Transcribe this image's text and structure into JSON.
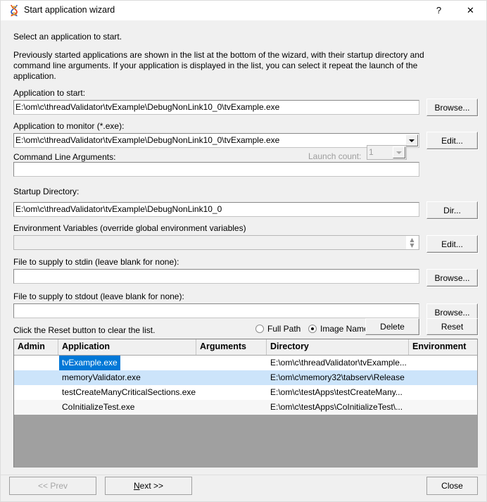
{
  "window": {
    "title": "Start application wizard",
    "icon": "dna-helix-icon",
    "help_label": "?",
    "close_label": "✕"
  },
  "intro": {
    "heading": "Select an application to start.",
    "paragraph_line1": "Previously started applications are shown in the list at the bottom of the wizard, with their startup directory and",
    "paragraph_line2": "command line arguments. If your application is displayed in the list, you can select it repeat the launch of the",
    "paragraph_line3": "application."
  },
  "fields": {
    "app_to_start": {
      "label": "Application to start:",
      "value": "E:\\om\\c\\threadValidator\\tvExample\\DebugNonLink10_0\\tvExample.exe",
      "button": "Browse..."
    },
    "app_to_monitor": {
      "label": "Application to monitor (*.exe):",
      "value": "E:\\om\\c\\threadValidator\\tvExample\\DebugNonLink10_0\\tvExample.exe",
      "button": "Edit..."
    },
    "command_line": {
      "label": "Command Line Arguments:",
      "value": ""
    },
    "launch_count": {
      "label": "Launch count:",
      "value": "1",
      "disabled": true
    },
    "startup_dir": {
      "label": "Startup Directory:",
      "value": "E:\\om\\c\\threadValidator\\tvExample\\DebugNonLink10_0",
      "button": "Dir..."
    },
    "env_vars": {
      "label": "Environment Variables (override global environment variables)",
      "value": "",
      "button": "Edit..."
    },
    "stdin": {
      "label": "File to supply to stdin (leave blank for none):",
      "value": "",
      "button": "Browse..."
    },
    "stdout": {
      "label": "File to supply to stdout (leave blank for none):",
      "value": "",
      "button": "Browse..."
    }
  },
  "list_controls": {
    "hint": "Click the Reset button to clear the list.",
    "radio_full_path": "Full Path",
    "radio_image_name": "Image Name",
    "selected_radio": "Image Name",
    "delete_button": "Delete",
    "reset_button": "Reset"
  },
  "table": {
    "columns": [
      "Admin",
      "Application",
      "Arguments",
      "Directory",
      "Environment"
    ],
    "rows": [
      {
        "admin": "",
        "application": "tvExample.exe",
        "arguments": "",
        "directory": "E:\\om\\c\\threadValidator\\tvExample...",
        "environment": "",
        "selected": true,
        "highlighted": false
      },
      {
        "admin": "",
        "application": "memoryValidator.exe",
        "arguments": "",
        "directory": "E:\\om\\c\\memory32\\tabserv\\Release",
        "environment": "",
        "selected": false,
        "highlighted": true
      },
      {
        "admin": "",
        "application": "testCreateManyCriticalSections.exe",
        "arguments": "",
        "directory": "E:\\om\\c\\testApps\\testCreateMany...",
        "environment": "",
        "selected": false,
        "highlighted": false
      },
      {
        "admin": "",
        "application": "CoInitializeTest.exe",
        "arguments": "",
        "directory": "E:\\om\\c\\testApps\\CoInitializeTest\\...",
        "environment": "",
        "selected": false,
        "highlighted": false
      }
    ]
  },
  "footer": {
    "prev": "<< Prev",
    "prev_disabled": true,
    "next_prefix": "",
    "next_underline": "N",
    "next_suffix": "ext >>",
    "close": "Close"
  },
  "colors": {
    "accent": "#0078d7",
    "row_highlight": "#cce4fa",
    "dialog_bg": "#f0f0f0",
    "list_empty_bg": "#a0a0a0"
  }
}
